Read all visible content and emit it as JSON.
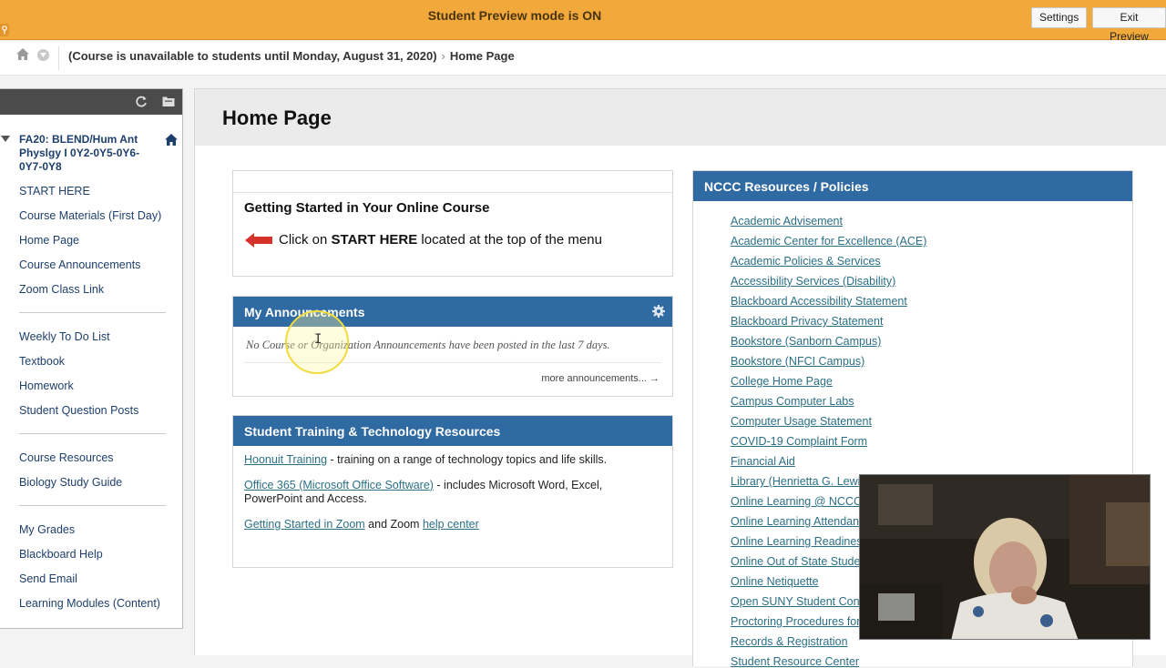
{
  "preview_bar": {
    "title": "Student Preview mode is ON",
    "settings_label": "Settings",
    "exit_label": "Exit Preview",
    "accent": "#f2a93b"
  },
  "breadcrumb": {
    "course_status": "(Course is unavailable to students until Monday, August 31, 2020)",
    "current": "Home Page"
  },
  "course_menu": {
    "course_title": "FA20: BLEND/Hum Ant Physlgy I 0Y2-0Y5-0Y6-0Y7-0Y8",
    "group1": [
      "START HERE",
      "Course Materials (First Day)",
      "Home Page",
      "Course Announcements",
      "Zoom Class Link"
    ],
    "group2": [
      "Weekly To Do List",
      "Textbook",
      "Homework",
      "Student Question Posts"
    ],
    "group3": [
      "Course Resources",
      "Biology Study Guide"
    ],
    "group4": [
      "My Grades",
      "Blackboard Help",
      "Send Email",
      "Learning Modules (Content)"
    ]
  },
  "page": {
    "title": "Home Page"
  },
  "getting_started": {
    "title": "Getting Started in Your Online Course",
    "prefix": "Click on ",
    "emphasis": "START HERE",
    "suffix": " located at the top of the menu"
  },
  "announcements": {
    "title": "My Announcements",
    "empty": "No Course or Organization Announcements have been posted in the last 7 days.",
    "more": "more announcements... →"
  },
  "training": {
    "title": "Student Training & Technology Resources",
    "row1_link": "Hoonuit Training",
    "row1_text": " - training on a range of technology topics and life skills.",
    "row2_link": "Office 365 (Microsoft Office Software)",
    "row2_text": " - includes Microsoft Word, Excel, PowerPoint and Access.",
    "row3_link1": "Getting Started in Zoom",
    "row3_mid": " and Zoom ",
    "row3_link2": "help center"
  },
  "resources": {
    "title": "NCCC Resources / Policies",
    "items": [
      "Academic Advisement",
      "Academic Center for Excellence (ACE)",
      "Academic Policies & Services",
      "Accessibility Services (Disability)",
      "Blackboard Accessibility Statement",
      "Blackboard Privacy Statement",
      "Bookstore (Sanborn Campus)",
      "Bookstore (NFCI Campus)",
      "College Home Page",
      "Campus Computer Labs",
      "Computer Usage Statement",
      "COVID-19 Complaint Form",
      "Financial Aid",
      "Library (Henrietta G. Lewis Library)",
      "Online Learning @ NCCC",
      "Online Learning Attendance",
      "Online Learning Readiness",
      "Online Out of State Students",
      "Online Netiquette",
      "Open SUNY Student Concierge",
      "Proctoring Procedures for Online",
      "Records & Registration",
      "Student Resource Center"
    ]
  },
  "colors": {
    "module_header": "#2f6aa2",
    "link": "#2b6f86",
    "menu_link": "#1e3f6c"
  }
}
